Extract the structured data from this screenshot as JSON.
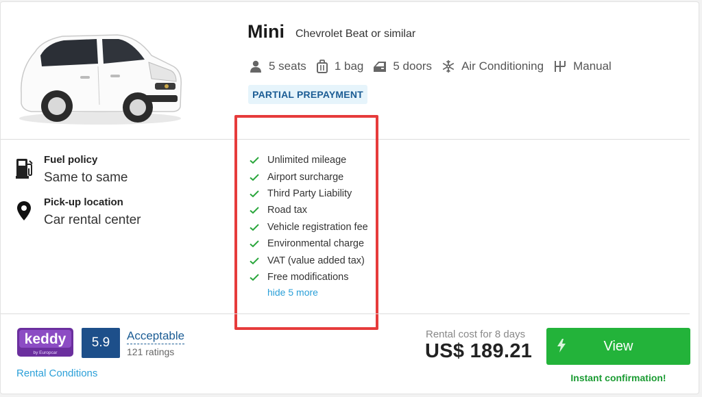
{
  "car": {
    "category": "Mini",
    "model": "Chevrolet Beat or similar"
  },
  "specs": [
    {
      "icon": "person-icon",
      "label": "5 seats"
    },
    {
      "icon": "luggage-icon",
      "label": "1 bag"
    },
    {
      "icon": "door-icon",
      "label": "5 doors"
    },
    {
      "icon": "snowflake-icon",
      "label": "Air Conditioning"
    },
    {
      "icon": "gearshift-icon",
      "label": "Manual"
    }
  ],
  "badge": "PARTIAL PREPAYMENT",
  "fuel_policy": {
    "label": "Fuel policy",
    "value": "Same to same"
  },
  "pickup": {
    "label": "Pick-up location",
    "value": "Car rental center"
  },
  "included": [
    "Unlimited mileage",
    "Airport surcharge",
    "Third Party Liability",
    "Road tax",
    "Vehicle registration fee",
    "Environmental charge",
    "VAT (value added tax)",
    "Free modifications"
  ],
  "hide_more": "hide 5 more",
  "supplier": {
    "name": "keddy",
    "sub": "by Europcar"
  },
  "rating": {
    "score": "5.9",
    "label": "Acceptable",
    "count": "121 ratings"
  },
  "rental_conditions": "Rental Conditions",
  "cost": {
    "label": "Rental cost for 8 days",
    "price": "US$ 189.21"
  },
  "view_button": "View",
  "instant_confirmation": "Instant confirmation!",
  "colors": {
    "accent_green": "#23b33a",
    "link_blue": "#2a9fd8",
    "score_blue": "#1d4f8a",
    "highlight_red": "#e63b3b",
    "badge_bg": "#e6f4fb"
  }
}
